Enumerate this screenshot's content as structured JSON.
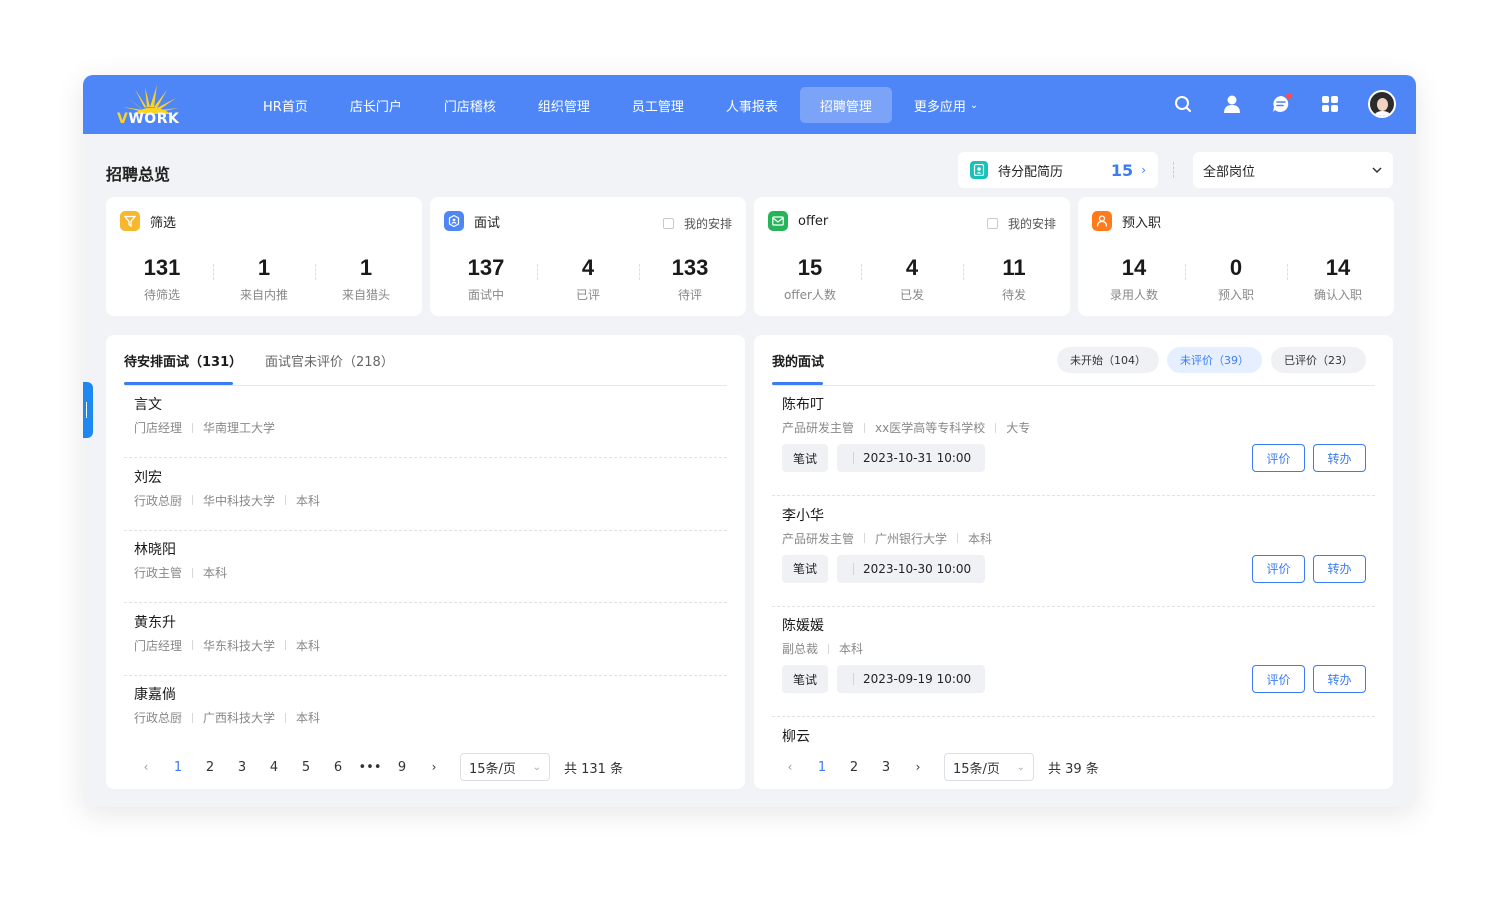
{
  "colors": {
    "primary": "#4f86f7",
    "accent": "#3b7cf5"
  },
  "logo": {
    "letter": "V",
    "rest": "WORK"
  },
  "nav": [
    {
      "label": "HR首页"
    },
    {
      "label": "店长门户"
    },
    {
      "label": "门店稽核"
    },
    {
      "label": "组织管理"
    },
    {
      "label": "员工管理"
    },
    {
      "label": "人事报表"
    },
    {
      "label": "招聘管理",
      "active": true
    },
    {
      "label": "更多应用",
      "has_dropdown": true
    }
  ],
  "top_icons": [
    "search-icon",
    "user-icon",
    "message-icon",
    "apps-icon"
  ],
  "page": {
    "title": "招聘总览",
    "pending": {
      "label": "待分配简历",
      "count": "15",
      "icon": "resume-icon"
    },
    "position_select": {
      "value": "全部岗位"
    }
  },
  "stats": [
    {
      "title": "筛选",
      "icon": "filter-icon",
      "color": "#f7b82d",
      "checkbox": null,
      "items": [
        {
          "num": "131",
          "label": "待筛选"
        },
        {
          "num": "1",
          "label": "来自内推"
        },
        {
          "num": "1",
          "label": "来自猎头"
        }
      ]
    },
    {
      "title": "面试",
      "icon": "interview-icon",
      "color": "#4f86f7",
      "checkbox": "我的安排",
      "items": [
        {
          "num": "137",
          "label": "面试中"
        },
        {
          "num": "4",
          "label": "已评"
        },
        {
          "num": "133",
          "label": "待评"
        }
      ]
    },
    {
      "title": "offer",
      "icon": "mail-icon",
      "color": "#27b35a",
      "checkbox": "我的安排",
      "items": [
        {
          "num": "15",
          "label": "offer人数"
        },
        {
          "num": "4",
          "label": "已发"
        },
        {
          "num": "11",
          "label": "待发"
        }
      ]
    },
    {
      "title": "预入职",
      "icon": "person-icon",
      "color": "#ff7a1a",
      "checkbox": null,
      "items": [
        {
          "num": "14",
          "label": "录用人数"
        },
        {
          "num": "0",
          "label": "预入职"
        },
        {
          "num": "14",
          "label": "确认入职"
        }
      ]
    }
  ],
  "left_panel": {
    "tabs": [
      {
        "label": "待安排面试（131）",
        "active": true
      },
      {
        "label": "面试官未评价（218）"
      }
    ],
    "items": [
      {
        "name": "言文",
        "meta": [
          "门店经理",
          "华南理工大学"
        ]
      },
      {
        "name": "刘宏",
        "meta": [
          "行政总厨",
          "华中科技大学",
          "本科"
        ]
      },
      {
        "name": "林晓阳",
        "meta": [
          "行政主管",
          "本科"
        ]
      },
      {
        "name": "黄东升",
        "meta": [
          "门店经理",
          "华东科技大学",
          "本科"
        ]
      },
      {
        "name": "康嘉倘",
        "meta": [
          "行政总厨",
          "广西科技大学",
          "本科"
        ]
      }
    ],
    "pagination": {
      "pages": [
        "1",
        "2",
        "3",
        "4",
        "5",
        "6",
        "•••",
        "9"
      ],
      "current": "1",
      "page_size": "15条/页",
      "total": "共 131 条"
    }
  },
  "right_panel": {
    "tab": "我的面试",
    "filters": [
      {
        "label": "未开始（104）"
      },
      {
        "label": "未评价（39）",
        "active": true
      },
      {
        "label": "已评价（23）"
      }
    ],
    "items": [
      {
        "name": "陈布叮",
        "meta": [
          "产品研发主管",
          "xx医学高等专科学校",
          "大专"
        ],
        "type": "笔试",
        "time": "2023-10-31 10:00",
        "btn_rate": "评价",
        "btn_transfer": "转办"
      },
      {
        "name": "李小华",
        "meta": [
          "产品研发主管",
          "广州银行大学",
          "本科"
        ],
        "type": "笔试",
        "time": "2023-10-30 10:00",
        "btn_rate": "评价",
        "btn_transfer": "转办"
      },
      {
        "name": "陈媛媛",
        "meta": [
          "副总裁",
          "本科"
        ],
        "type": "笔试",
        "time": "2023-09-19 10:00",
        "btn_rate": "评价",
        "btn_transfer": "转办"
      },
      {
        "name": "柳云",
        "meta": [],
        "type": "",
        "time": "",
        "btn_rate": "",
        "btn_transfer": ""
      }
    ],
    "pagination": {
      "pages": [
        "1",
        "2",
        "3"
      ],
      "current": "1",
      "page_size": "15条/页",
      "total": "共 39 条"
    }
  }
}
